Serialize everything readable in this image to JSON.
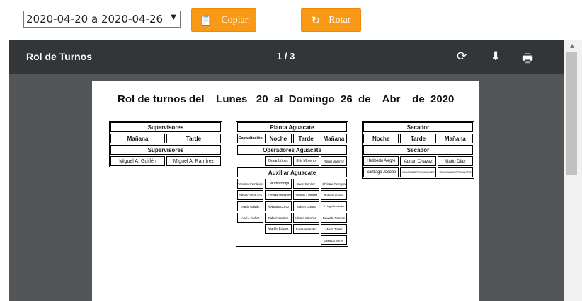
{
  "toolbar": {
    "week": "2020-04-20 a 2020-04-26",
    "copy_label": "Copiar",
    "rotate_label": "Rotar",
    "accent": "#f99a17"
  },
  "viewer": {
    "title": "Rol de Turnos",
    "pages": "1 / 3",
    "icons": [
      "rotate-icon",
      "download-icon",
      "print-icon"
    ]
  },
  "doc": {
    "title": "Rol de turnos del    Lunes   20  al  Domingo  26  de    Abr    de  2020",
    "supervisores": {
      "header": "Supervisores",
      "shifts": [
        "Mañana",
        "Tarde"
      ],
      "header2": "Supervisores",
      "names": [
        "Miguel A. Guillén",
        "Miguel A. Ramírez"
      ]
    },
    "planta": {
      "header": "Planta Aguacate",
      "cols": [
        "Capacitación",
        "Noche",
        "Tarde",
        "Mañana"
      ],
      "operadores_header": "Operadores Aguacate",
      "operadores": [
        "",
        "Omar López",
        "Eric Moreno",
        "Rafael Martínez"
      ],
      "auxiliar_header": "Auxiliar Aguacate",
      "auxiliar": [
        [
          "Francisco Fernández",
          "Claudio Borja",
          "Javier Benítez",
          "Christian Ferreyra"
        ],
        [
          "Gilberto Verduzco",
          "L. Fernando Hernández",
          "Fernando J. Martínez",
          "Roberto García"
        ],
        [
          "Aarón Galván",
          "Alejandro Quiroz",
          "Brayan Ortega",
          "V. Hugo Hernández"
        ],
        [
          "Abel J. Nuñez",
          "Rafael Ramírez",
          "Lázaro Sánchez",
          "Eduardo Parente"
        ],
        [
          "",
          "Martín López",
          "Juan Hernández",
          "Martín Torrez"
        ],
        [
          "",
          "",
          "",
          "Gerardo Torres"
        ]
      ]
    },
    "secador": {
      "header": "Secador",
      "cols": [
        "Noche",
        "Tarde",
        "Mañana"
      ],
      "header2": "Secador",
      "row1": [
        "Heriberto Alegre",
        "Adrián Chavez",
        "Mario Díaz"
      ],
      "row2": [
        "Santiago Jacobo",
        "CARLOS ALBERTO ROJAS URIBE",
        "JESUS MANUEL ORTEGA LOPEZ"
      ]
    }
  }
}
